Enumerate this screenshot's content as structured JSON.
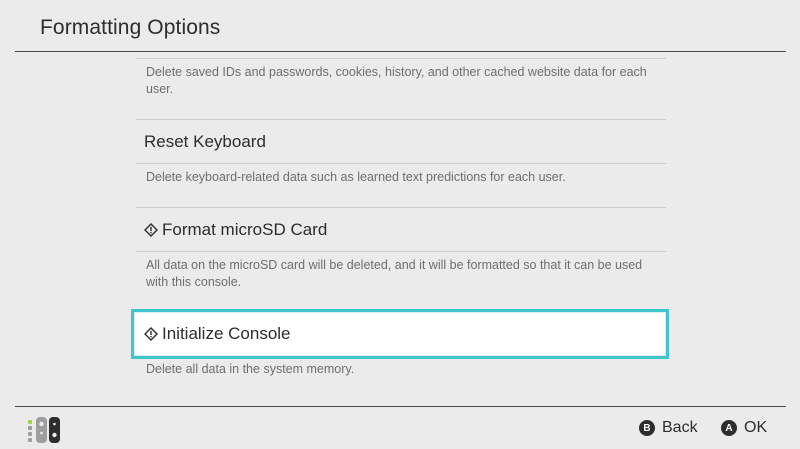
{
  "header": {
    "title": "Formatting Options"
  },
  "items": [
    {
      "title": "",
      "description": "Delete saved IDs and passwords, cookies, history, and other cached website data for each user."
    },
    {
      "title": "Reset Keyboard",
      "description": "Delete keyboard-related data such as learned text predictions for each user."
    },
    {
      "title": "Format microSD Card",
      "icon": "warning-diamond-icon",
      "description": "All data on the microSD card will be deleted, and it will be formatted so that it can be used with this console."
    },
    {
      "title": "Initialize Console",
      "icon": "warning-diamond-icon",
      "selected": true,
      "description": "Delete all data in the system memory."
    }
  ],
  "footer": {
    "controller_icon": "joycon-controller-icon",
    "back": {
      "glyph": "B",
      "label": "Back"
    },
    "ok": {
      "glyph": "A",
      "label": "OK"
    }
  },
  "colors": {
    "selection_border": "#3ec6cc",
    "background": "#ebebeb",
    "controller_left": "#9cd44c"
  }
}
